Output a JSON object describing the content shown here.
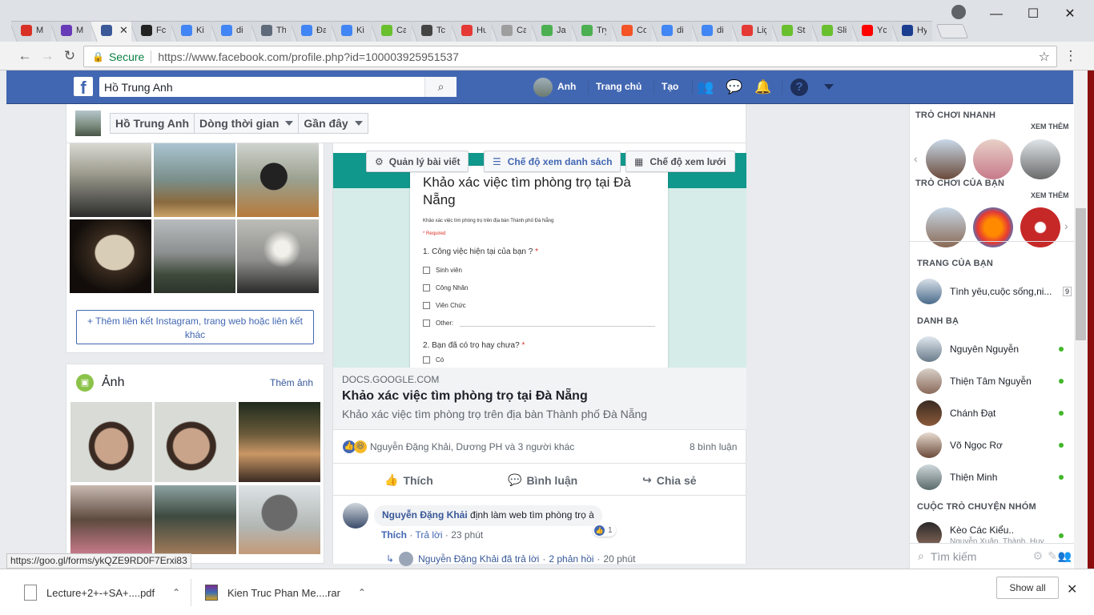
{
  "browser": {
    "tabs": [
      {
        "icon": "gmail-icon",
        "label": "M",
        "color": "#d93025"
      },
      {
        "icon": "tasks-icon",
        "label": "M",
        "color": "#673ab7"
      },
      {
        "icon": "facebook-icon",
        "label": "",
        "color": "#3b5998",
        "active": true
      },
      {
        "icon": "github-icon",
        "label": "Fc",
        "color": "#222222"
      },
      {
        "icon": "translate-icon",
        "label": "Ki",
        "color": "#4285f4"
      },
      {
        "icon": "google-icon",
        "label": "di",
        "color": "#4285f4"
      },
      {
        "icon": "building-icon",
        "label": "Th",
        "color": "#5f6b7a"
      },
      {
        "icon": "translate-icon",
        "label": "Đa",
        "color": "#4285f4"
      },
      {
        "icon": "translate-icon",
        "label": "Ki",
        "color": "#4285f4"
      },
      {
        "icon": "green-circle-icon",
        "label": "Ca",
        "color": "#6abf2e"
      },
      {
        "icon": "panda-icon",
        "label": "Tc",
        "color": "#444444"
      },
      {
        "icon": "t-icon",
        "label": "Hu",
        "color": "#e53935"
      },
      {
        "icon": "document-icon",
        "label": "Ca",
        "color": "#9e9e9e"
      },
      {
        "icon": "w3-icon",
        "label": "Ja",
        "color": "#4caf50"
      },
      {
        "icon": "w3-icon",
        "label": "Try",
        "color": "#4caf50"
      },
      {
        "icon": "microsoft-icon",
        "label": "Co",
        "color": "#f35325"
      },
      {
        "icon": "google-icon",
        "label": "di",
        "color": "#4285f4"
      },
      {
        "icon": "google-icon",
        "label": "di",
        "color": "#4285f4"
      },
      {
        "icon": "pdf-icon",
        "label": "Liç",
        "color": "#e53935"
      },
      {
        "icon": "green-circle-icon",
        "label": "St",
        "color": "#6abf2e"
      },
      {
        "icon": "green-circle-icon",
        "label": "Sli",
        "color": "#6abf2e"
      },
      {
        "icon": "youtube-icon",
        "label": "Yc",
        "color": "#ff0000"
      },
      {
        "icon": "hyundai-icon",
        "label": "Hy",
        "color": "#1a3d8f"
      }
    ],
    "secure_label": "Secure",
    "url": "https://www.facebook.com/profile.php?id=100003925951537"
  },
  "fb_header": {
    "search_value": "Hồ Trung Anh",
    "user_name": "Anh",
    "home_label": "Trang chủ",
    "create_label": "Tạo"
  },
  "timeline": {
    "name": "Hồ Trung Anh",
    "section": "Dòng thời gian",
    "sort": "Gần đây"
  },
  "left": {
    "add_link_label": "Thêm liên kết Instagram, trang web hoặc liên kết khác",
    "photos_title": "Ảnh",
    "add_photos_label": "Thêm ảnh"
  },
  "post": {
    "manage_label": "Quản lý bài viết",
    "list_view_label": "Chế độ xem danh sách",
    "grid_view_label": "Chế độ xem lưới",
    "form": {
      "title": "Khảo xác việc tìm phòng trọ tại Đà Nẵng",
      "desc": "Khảo xác việc tìm phòng trọ trên địa bàn Thành phố Đà Nẵng",
      "required": "* Required",
      "q1": "1. Công việc hiện tại của bạn ?",
      "options": [
        "Sinh viên",
        "Công Nhân",
        "Viên Chức",
        "Other:"
      ],
      "q2": "2. Bạn đã có trọ hay chưa?",
      "q2_first": "Có"
    },
    "link_domain": "DOCS.GOOGLE.COM",
    "link_title": "Khảo xác việc tìm phòng trọ tại Đà Nẵng",
    "link_desc": "Khảo xác việc tìm phòng trọ trên địa bàn Thành phố Đà Nẵng",
    "reactions_text": "Nguyễn Đặng Khải, Dương PH và 3 người khác",
    "comment_count": "8 bình luận",
    "like_label": "Thích",
    "comment_label": "Bình luận",
    "share_label": "Chia sẻ",
    "comment": {
      "author": "Nguyễn Đặng Khải",
      "text": "định làm web tìm phòng trọ à",
      "like": "Thích",
      "reply": "Trả lời",
      "time": "23 phút",
      "likes": "1"
    },
    "reply_summary": {
      "author_text": "Nguyễn Đặng Khải đã trả lời",
      "replies": "2 phản hồi",
      "time": "20 phút"
    }
  },
  "right": {
    "quick_games": "TRÒ CHƠI NHANH",
    "see_more_1": "XEM THÊM",
    "your_games": "TRÒ CHƠI CỦA BẠN",
    "see_more_2": "XEM THÊM",
    "your_pages": "TRANG CỦA BẠN",
    "page_name": "Tình yêu,cuộc sống,ni...",
    "page_badge": "9",
    "contacts_title": "DANH BẠ",
    "contacts": [
      "Nguyên Nguyễn",
      "Thiện Tâm Nguyễn",
      "Chánh Đạt",
      "Võ Ngọc Rơ",
      "Thiện Minh"
    ],
    "group_chats_title": "CUỘC TRÒ CHUYỆN NHÓM",
    "group_name": "Kèo Các Kiểu..",
    "group_members": "Nguyễn Xuân, Thành, Huy",
    "search_placeholder": "Tìm kiếm"
  },
  "status_url": "https://goo.gl/forms/ykQZE9RD0F7Erxi83",
  "downloads": {
    "file1": "Lecture+2+-+SA+....pdf",
    "file2": "Kien Truc Phan Me....rar",
    "show_all": "Show all"
  }
}
